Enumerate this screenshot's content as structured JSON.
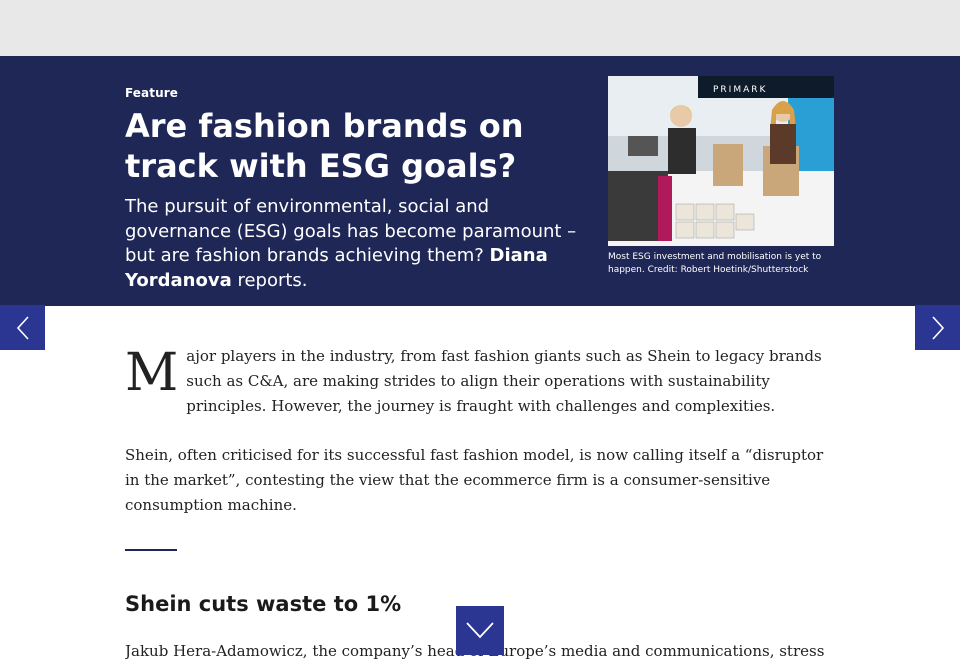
{
  "hero": {
    "kicker": "Feature",
    "headline": "Are fashion brands on track with ESG goals?",
    "standfirst_lead": "The pursuit of environmental, social and governance (ESG) goals has become paramount – but are fashion brands achieving them? ",
    "author": "Diana Yordanova",
    "standfirst_tail": " reports.",
    "image_caption": "Most ESG investment and mobilisation is yet to happen. Credit: Robert Hoetink/Shutterstock",
    "image_signage": "PRIMARK"
  },
  "nav": {
    "prev_icon": "chevron-left-icon",
    "next_icon": "chevron-right-icon"
  },
  "article": {
    "dropcap": "M",
    "para1_rest": "ajor players in the industry, from fast fashion giants such as Shein to legacy brands such as C&A, are making strides to align their operations with sustainability principles. However, the journey is fraught with challenges and complexities.",
    "para2": "Shein, often criticised for its successful fast fashion model, is now calling itself a “disruptor in the market”, contesting the view that the ecommerce firm is a consumer-sensitive consumption machine.",
    "subhead": "Shein cuts waste to 1%",
    "para3": "Jakub Hera-Adamowicz, the company’s head of Europe’s media and communications, stressed that"
  },
  "scroll_button": {
    "icon": "chevron-down-icon"
  },
  "colors": {
    "hero_bg": "#1f2756",
    "accent": "#2b3592",
    "top_bar": "#e8e8e8"
  }
}
